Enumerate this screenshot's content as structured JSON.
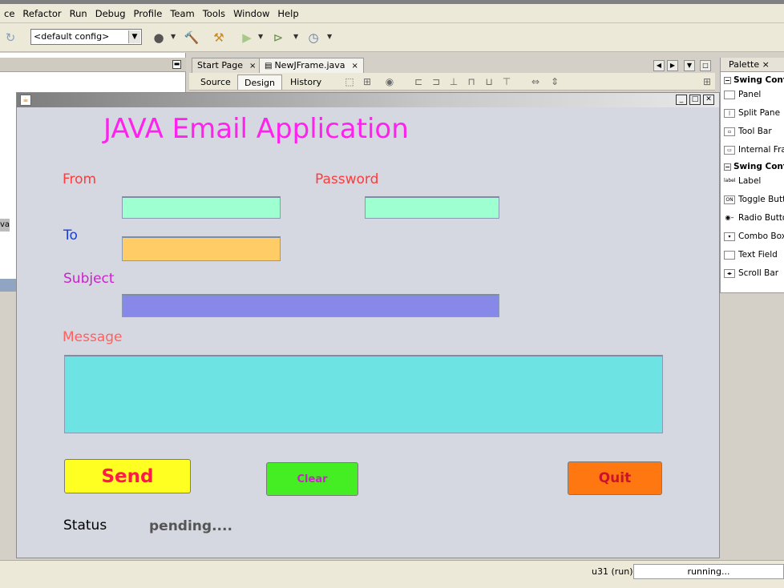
{
  "menu": [
    "ce",
    "Refactor",
    "Run",
    "Debug",
    "Profile",
    "Team",
    "Tools",
    "Window",
    "Help"
  ],
  "toolbar": {
    "config_value": "<default config>"
  },
  "left_panel": {
    "stub_text": "va"
  },
  "editor": {
    "tabs": [
      {
        "label": "Start Page",
        "close": "×"
      },
      {
        "label": "NewJFrame.java",
        "close": "×"
      }
    ],
    "views": [
      "Source",
      "Design",
      "History"
    ]
  },
  "palette": {
    "tab_label": "Palette",
    "tab_close": "×",
    "categories": [
      "Swing Cont",
      "Swing Cont"
    ],
    "containers": [
      "Panel",
      "Split Pane",
      "Tool Bar",
      "Internal Fra"
    ],
    "controls": [
      "Label",
      "Toggle Butt",
      "Radio Butto",
      "Combo Box",
      "Text Field",
      "Scroll Bar"
    ]
  },
  "app": {
    "title": "JAVA Email Application",
    "labels": {
      "from": "From",
      "password": "Password",
      "to": "To",
      "subject": "Subject",
      "message": "Message",
      "status": "Status"
    },
    "status_value": "pending....",
    "buttons": {
      "send": "Send",
      "clear": "Clear",
      "quit": "Quit"
    },
    "colors": {
      "title": "#ff22ee",
      "from_label": "#ff3b3b",
      "to_label": "#1a3fd6",
      "subject_label": "#cc22cc",
      "message_label": "#ff6060",
      "from_field": "#9effd0",
      "password_field": "#9effd0",
      "to_field": "#ffcc66",
      "subject_field": "#8888e8",
      "message_area": "#6ee3e3",
      "send_button": "#ffff22",
      "clear_button": "#44ee22",
      "quit_button": "#ff7711"
    }
  },
  "statusbar": {
    "run_label": "u31 (run)",
    "run_status": "running..."
  }
}
